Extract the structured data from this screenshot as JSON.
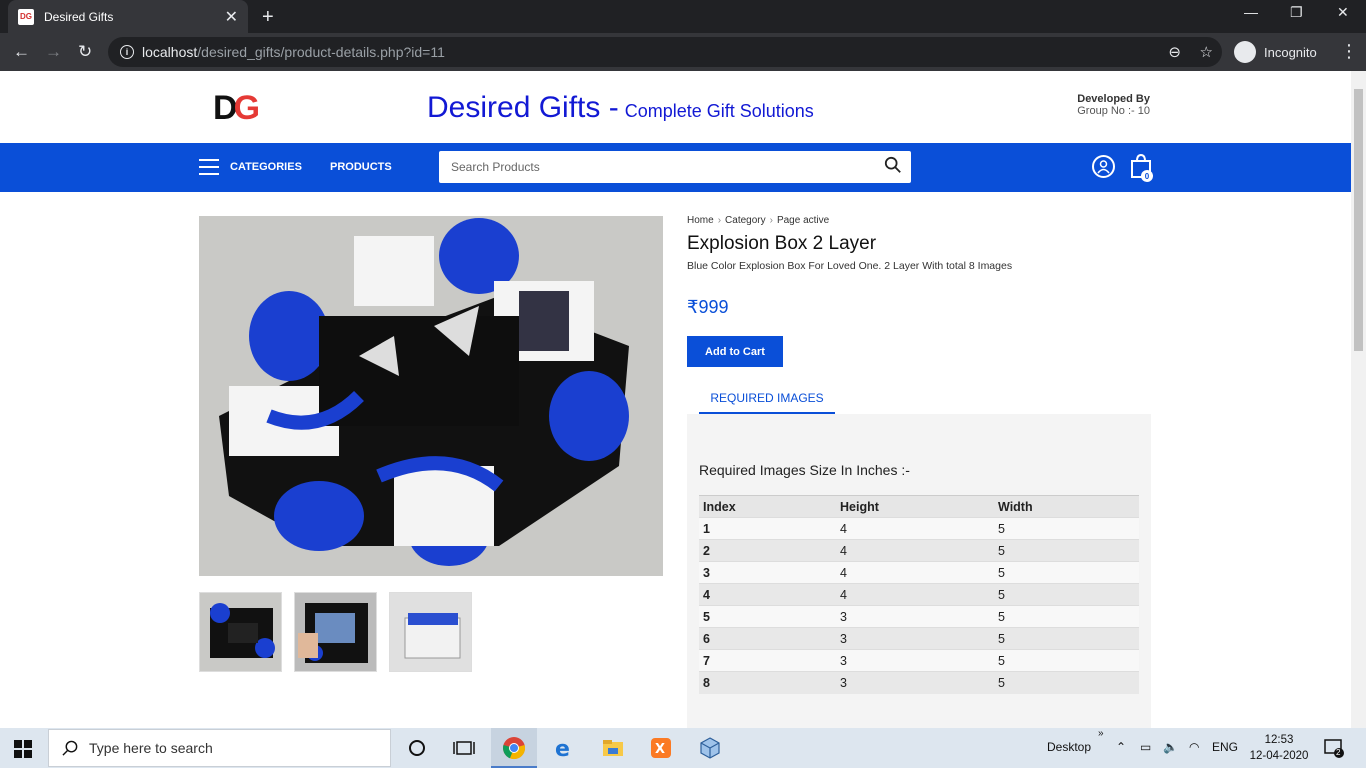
{
  "browser": {
    "tab_title": "Desired Gifts",
    "tab_favicon_text": "DG",
    "url_host": "localhost",
    "url_path": "/desired_gifts/product-details.php?id=11",
    "profile_label": "Incognito"
  },
  "site": {
    "logo_d": "D",
    "logo_g": "G",
    "title": "Desired Gifts -",
    "subtitle": "Complete Gift Solutions",
    "developed_by": "Developed By",
    "group": "Group No :- 10"
  },
  "nav": {
    "categories": "CATEGORIES",
    "products": "PRODUCTS",
    "search_placeholder": "Search Products",
    "cart_count": "0"
  },
  "breadcrumb": [
    "Home",
    "Category",
    "Page active"
  ],
  "product": {
    "name": "Explosion Box 2 Layer",
    "description": "Blue Color Explosion Box For Loved One. 2 Layer With total 8 Images",
    "price": "₹999",
    "add_to_cart": "Add to Cart",
    "tab_label": "REQUIRED IMAGES",
    "sizes_heading": "Required Images Size In Inches :-"
  },
  "table": {
    "headers": [
      "Index",
      "Height",
      "Width"
    ],
    "rows": [
      [
        "1",
        "4",
        "5"
      ],
      [
        "2",
        "4",
        "5"
      ],
      [
        "3",
        "4",
        "5"
      ],
      [
        "4",
        "4",
        "5"
      ],
      [
        "5",
        "3",
        "5"
      ],
      [
        "6",
        "3",
        "5"
      ],
      [
        "7",
        "3",
        "5"
      ],
      [
        "8",
        "3",
        "5"
      ]
    ]
  },
  "taskbar": {
    "search_placeholder": "Type here to search",
    "desktop_label": "Desktop",
    "language": "ENG",
    "time": "12:53",
    "date": "12-04-2020",
    "notification_count": "2"
  },
  "colors": {
    "brand_blue": "#0a4fd8",
    "title_blue": "#1219d4",
    "logo_red": "#e53935"
  }
}
